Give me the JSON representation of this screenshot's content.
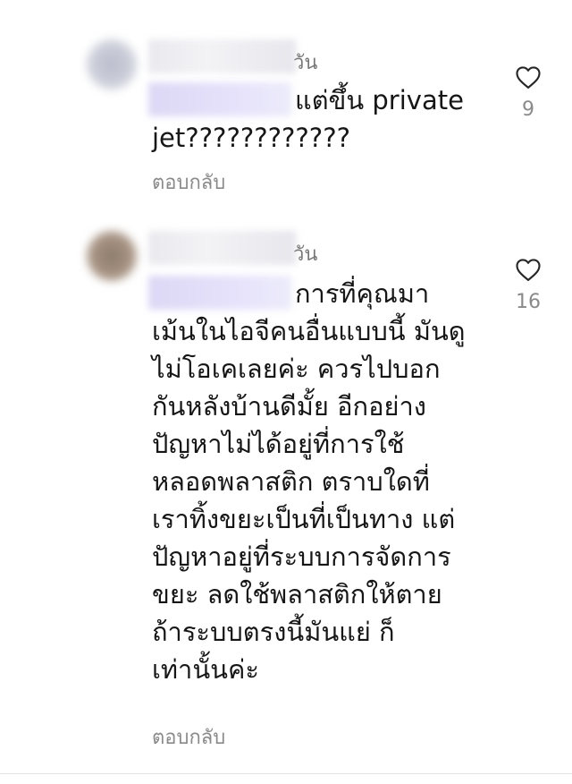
{
  "comments": [
    {
      "time_suffix": "วัน",
      "text": "แต่ขึ้น private\njet????????????",
      "reply_label": "ตอบกลับ",
      "like_count": "9"
    },
    {
      "time_suffix": "วัน",
      "text": "การที่คุณมา\nเม้นในไอจีคนอื่นแบบนี้ มันดู\nไม่โอเคเลยค่ะ ควรไปบอก\nกันหลังบ้านดีมั้ย อีกอย่าง\nปัญหาไม่ได้อยู่ที่การใช้\nหลอดพลาสติก ตราบใดที่\nเราทิ้งขยะเป็นที่เป็นทาง แต่\nปัญหาอยู่ที่ระบบการจัดการ\nขยะ ลดใช้พลาสติกให้ตาย\nถ้าระบบตรงนี้มันแย่ ก็\nเท่านั้นค่ะ",
      "reply_label": "ตอบกลับ",
      "like_count": "16"
    }
  ],
  "colors": {
    "text": "#161616",
    "muted": "#8a8a8a",
    "heart_outline": "#262626"
  },
  "icons": [
    "heart-outline-icon"
  ]
}
